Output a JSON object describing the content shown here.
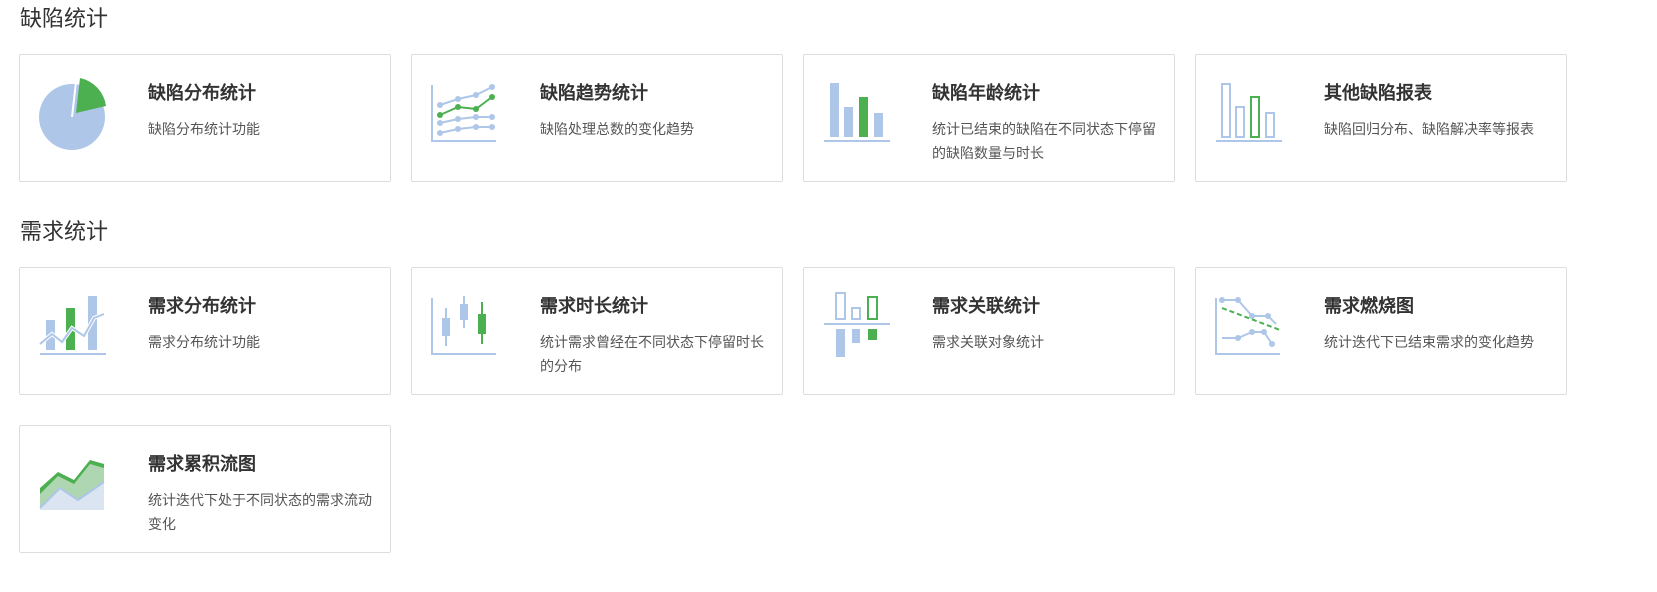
{
  "sections": [
    {
      "title": "缺陷统计",
      "cards": [
        {
          "title": "缺陷分布统计",
          "desc": "缺陷分布统计功能",
          "icon": "pie-chart-icon"
        },
        {
          "title": "缺陷趋势统计",
          "desc": "缺陷处理总数的变化趋势",
          "icon": "line-trend-icon"
        },
        {
          "title": "缺陷年龄统计",
          "desc": "统计已结束的缺陷在不同状态下停留的缺陷数量与时长",
          "icon": "bar-chart-icon"
        },
        {
          "title": "其他缺陷报表",
          "desc": "缺陷回归分布、缺陷解决率等报表",
          "icon": "outline-bar-chart-icon"
        }
      ]
    },
    {
      "title": "需求统计",
      "cards": [
        {
          "title": "需求分布统计",
          "desc": "需求分布统计功能",
          "icon": "bar-line-combo-icon"
        },
        {
          "title": "需求时长统计",
          "desc": "统计需求曾经在不同状态下停留时长的分布",
          "icon": "candlestick-icon"
        },
        {
          "title": "需求关联统计",
          "desc": "需求关联对象统计",
          "icon": "diverging-bar-icon"
        },
        {
          "title": "需求燃烧图",
          "desc": "统计迭代下已结束需求的变化趋势",
          "icon": "burndown-icon"
        },
        {
          "title": "需求累积流图",
          "desc": "统计迭代下处于不同状态的需求流动变化",
          "icon": "area-chart-icon"
        }
      ]
    }
  ],
  "colors": {
    "blue": "#aec6e8",
    "green": "#4caf50",
    "border": "#dddddd"
  }
}
